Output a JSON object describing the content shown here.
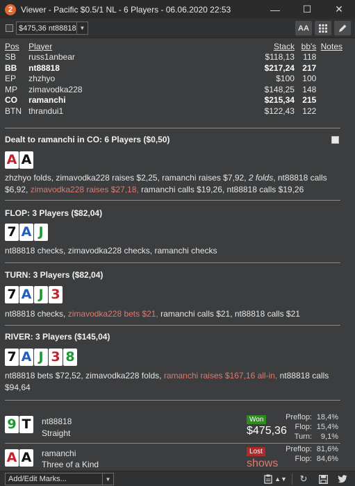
{
  "window": {
    "app_icon": "2",
    "title": "Viewer - Pacific $0.5/1 NL - 6 Players - 06.06.2020 22:53",
    "minimize": "—",
    "maximize": "☐",
    "close": "✕"
  },
  "toolbar": {
    "hand_select_value": "$475,36 nt88818",
    "font_btn": "AA",
    "grid_icon": "grid-icon",
    "edit_icon": "pencil-icon"
  },
  "players": {
    "headers": {
      "pos": "Pos",
      "player": "Player",
      "stack": "Stack",
      "bbs": "bb's",
      "notes": "Notes"
    },
    "rows": [
      {
        "pos": "SB",
        "player": "russ1anbear",
        "stack": "$118,13",
        "bbs": "118",
        "bold": false
      },
      {
        "pos": "BB",
        "player": "nt88818",
        "stack": "$217,24",
        "bbs": "217",
        "bold": true
      },
      {
        "pos": "EP",
        "player": "zhzhyo",
        "stack": "$100",
        "bbs": "100",
        "bold": false
      },
      {
        "pos": "MP",
        "player": "zimavodka228",
        "stack": "$148,25",
        "bbs": "148",
        "bold": false
      },
      {
        "pos": "CO",
        "player": "ramanchi",
        "stack": "$215,34",
        "bbs": "215",
        "bold": true
      },
      {
        "pos": "BTN",
        "player": "thrandui1",
        "stack": "$122,43",
        "bbs": "122",
        "bold": false
      }
    ]
  },
  "preflop": {
    "title": "Dealt to ramanchi in CO: 6 Players ($0,50)",
    "cards": [
      {
        "rank": "A",
        "suit": "heart"
      },
      {
        "rank": "A",
        "suit": "spade"
      }
    ],
    "a1": "zhzhyo folds, zimavodka228 raises $2,25, ramanchi raises $7,92, ",
    "a2": "2 folds",
    "a3": ", nt88818 calls $6,92, ",
    "a4": "zimavodka228 raises $27,18,",
    "a5": " ramanchi calls $19,26, nt88818 calls $19,26"
  },
  "flop": {
    "title": "FLOP: 3 Players ($82,04)",
    "cards": [
      {
        "rank": "7",
        "suit": "spade"
      },
      {
        "rank": "A",
        "suit": "diamond"
      },
      {
        "rank": "J",
        "suit": "club"
      }
    ],
    "a1": "nt88818 checks, zimavodka228 checks, ramanchi checks"
  },
  "turn": {
    "title": "TURN: 3 Players ($82,04)",
    "cards": [
      {
        "rank": "7",
        "suit": "spade"
      },
      {
        "rank": "A",
        "suit": "diamond"
      },
      {
        "rank": "J",
        "suit": "club"
      },
      {
        "rank": "3",
        "suit": "heart"
      }
    ],
    "a1": "nt88818 checks, ",
    "a2": "zimavodka228 bets $21,",
    "a3": " ramanchi calls $21, nt88818 calls $21"
  },
  "river": {
    "title": "RIVER: 3 Players ($145,04)",
    "cards": [
      {
        "rank": "7",
        "suit": "spade"
      },
      {
        "rank": "A",
        "suit": "diamond"
      },
      {
        "rank": "J",
        "suit": "club"
      },
      {
        "rank": "3",
        "suit": "heart"
      },
      {
        "rank": "8",
        "suit": "club"
      }
    ],
    "a1": "nt88818 bets $72,52, zimavodka228 folds, ",
    "a2": "ramanchi raises $167,16 all-in,",
    "a3": " nt88818 calls $94,64"
  },
  "results": [
    {
      "cards": [
        {
          "rank": "9",
          "suit": "club"
        },
        {
          "rank": "T",
          "suit": "spade"
        }
      ],
      "player": "nt88818",
      "hand": "Straight",
      "status": "Won",
      "amount": "$475,36",
      "equity": [
        {
          "label": "Preflop:",
          "value": "18,4%"
        },
        {
          "label": "Flop:",
          "value": "15,4%"
        },
        {
          "label": "Turn:",
          "value": "9,1%"
        }
      ]
    },
    {
      "cards": [
        {
          "rank": "A",
          "suit": "heart"
        },
        {
          "rank": "A",
          "suit": "spade"
        }
      ],
      "player": "ramanchi",
      "hand": "Three of a Kind",
      "status": "Lost",
      "amount": "shows",
      "equity": [
        {
          "label": "Preflop:",
          "value": "81,6%"
        },
        {
          "label": "Flop:",
          "value": "84,6%"
        }
      ]
    }
  ],
  "bottombar": {
    "marks_value": "Add/Edit Marks...",
    "icons": [
      "clipboard-icon",
      "sort-icon",
      "refresh-icon",
      "save-icon",
      "twitter-icon"
    ]
  },
  "colors": {
    "background": "#3b3d3f",
    "titlebar": "#2b2b2b",
    "highlight_action": "#e07a6e",
    "won_badge": "#2f8a1f",
    "lost_badge": "#b02a2a",
    "spade": "#111111",
    "heart": "#c8202a",
    "diamond": "#1f5fbf",
    "club": "#1a9a2e"
  }
}
